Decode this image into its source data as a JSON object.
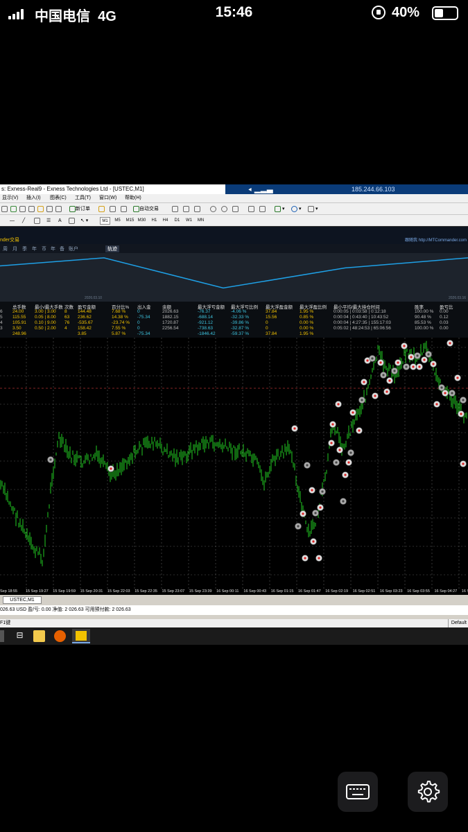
{
  "status_bar": {
    "carrier": "中国电信",
    "network": "4G",
    "time": "15:46",
    "battery_percent": "40%",
    "battery_level": 0.4
  },
  "terminal": {
    "window_title": "s: Exness-Real9 - Exness Technologies Ltd - [USTEC,M1]",
    "server_ip": "185.244.66.103",
    "menu": [
      "显示(V)",
      "插入(I)",
      "图表(C)",
      "工具(T)",
      "窗口(W)",
      "帮助(H)"
    ],
    "toolbar": {
      "new_order": "新订单",
      "auto_trading": "自动交易"
    },
    "timeframes": [
      "M1",
      "M5",
      "M15",
      "M30",
      "H1",
      "H4",
      "D1",
      "W1",
      "MN"
    ],
    "active_timeframe": "M1",
    "panel_left_title": "nder交易",
    "panel_right_title": "跟随我 http://MTCommander.com",
    "panel_tabs": [
      "周",
      "月",
      "季",
      "年",
      "币",
      "年",
      "备",
      "账户"
    ],
    "panel_active_tab": "轨迹",
    "equity_dates": [
      "2026.03.10",
      "2026.03.16"
    ],
    "equity_values": [
      0.25,
      0.05,
      0.8,
      0.3,
      0.05
    ],
    "stats": {
      "headers": [
        "总手数",
        "最小/最大手数",
        "次数",
        "盈亏金额",
        "百分比%",
        "出入金",
        "余额",
        "最大浮亏金额",
        "最大浮亏比例",
        "最大浮盈金额",
        "最大浮盈比例",
        "最小平均/最大持仓时间",
        "胜率",
        "盈亏比"
      ],
      "rows": [
        [
          "6",
          "24.00",
          "3.00 | 3.00",
          "8",
          "144.48",
          "7.68 %",
          "0",
          "2026.63",
          "-76.37",
          "-4.06 %",
          "37.84",
          "1.95 %",
          "0:00:05 | 0:03:58 | 0:12:18",
          "100.00 %",
          "0.00"
        ],
        [
          "5",
          "115.55",
          "0.05 | 8.00",
          "63",
          "236.62",
          "14.38 %",
          "-75.34",
          "1882.15",
          "-688.14",
          "-32.33 %",
          "15.56",
          "0.85 %",
          "0:00:04 | 0:43:40 | 10:43:52",
          "90.48 %",
          "0.12"
        ],
        [
          "4",
          "105.91",
          "0.10 | 9.00",
          "76",
          "-535.67",
          "-23.74 %",
          "0",
          "1720.87",
          "-921.12",
          "-39.86 %",
          "0",
          "0.00 %",
          "0:00:04 | 4:27:35 | 155:17:03",
          "85.53 %",
          "0.03"
        ],
        [
          "3",
          "3.50",
          "0.50 | 2.00",
          "4",
          "158.42",
          "7.55 %",
          "0",
          "2256.54",
          "-738.63",
          "-32.87 %",
          "0",
          "0.00 %",
          "0:05:02 | 48:24:53 | 65:06:56",
          "100.00 %",
          "0.00"
        ],
        [
          "",
          "248.96",
          "",
          "",
          "3.85",
          "5.87 %",
          "-75.34",
          "",
          "-1846.42",
          "-59.37 %",
          "37.84",
          "1.95 %",
          "",
          "",
          ""
        ]
      ]
    },
    "x_axis_labels": [
      "Sep 18:55",
      "15 Sep 19:27",
      "15 Sep 19:59",
      "15 Sep 20:31",
      "15 Sep 22:03",
      "15 Sep 22:35",
      "15 Sep 23:07",
      "15 Sep 23:39",
      "16 Sep 00:11",
      "16 Sep 00:43",
      "16 Sep 01:15",
      "16 Sep 01:47",
      "16 Sep 02:19",
      "16 Sep 02:51",
      "16 Sep 03:23",
      "16 Sep 03:55",
      "16 Sep 04:27",
      "16 Sep 0"
    ],
    "chart_tab": "USTEC,M1",
    "account_line": "026.63 USD  盈/亏: 0.00  净值: 2 026.63  可用预付款: 2 026.63",
    "status_left": "F1键",
    "status_right": "Default",
    "colors": {
      "candles": "#22cc22",
      "equity_line": "#1ea0e6",
      "header_yellow": "#f2c200",
      "value_cyan": "#3ec5e0",
      "title_blue": "#0a3b78"
    }
  },
  "overlay_buttons": [
    {
      "icon": "keyboard-icon"
    },
    {
      "icon": "gear-icon"
    }
  ]
}
